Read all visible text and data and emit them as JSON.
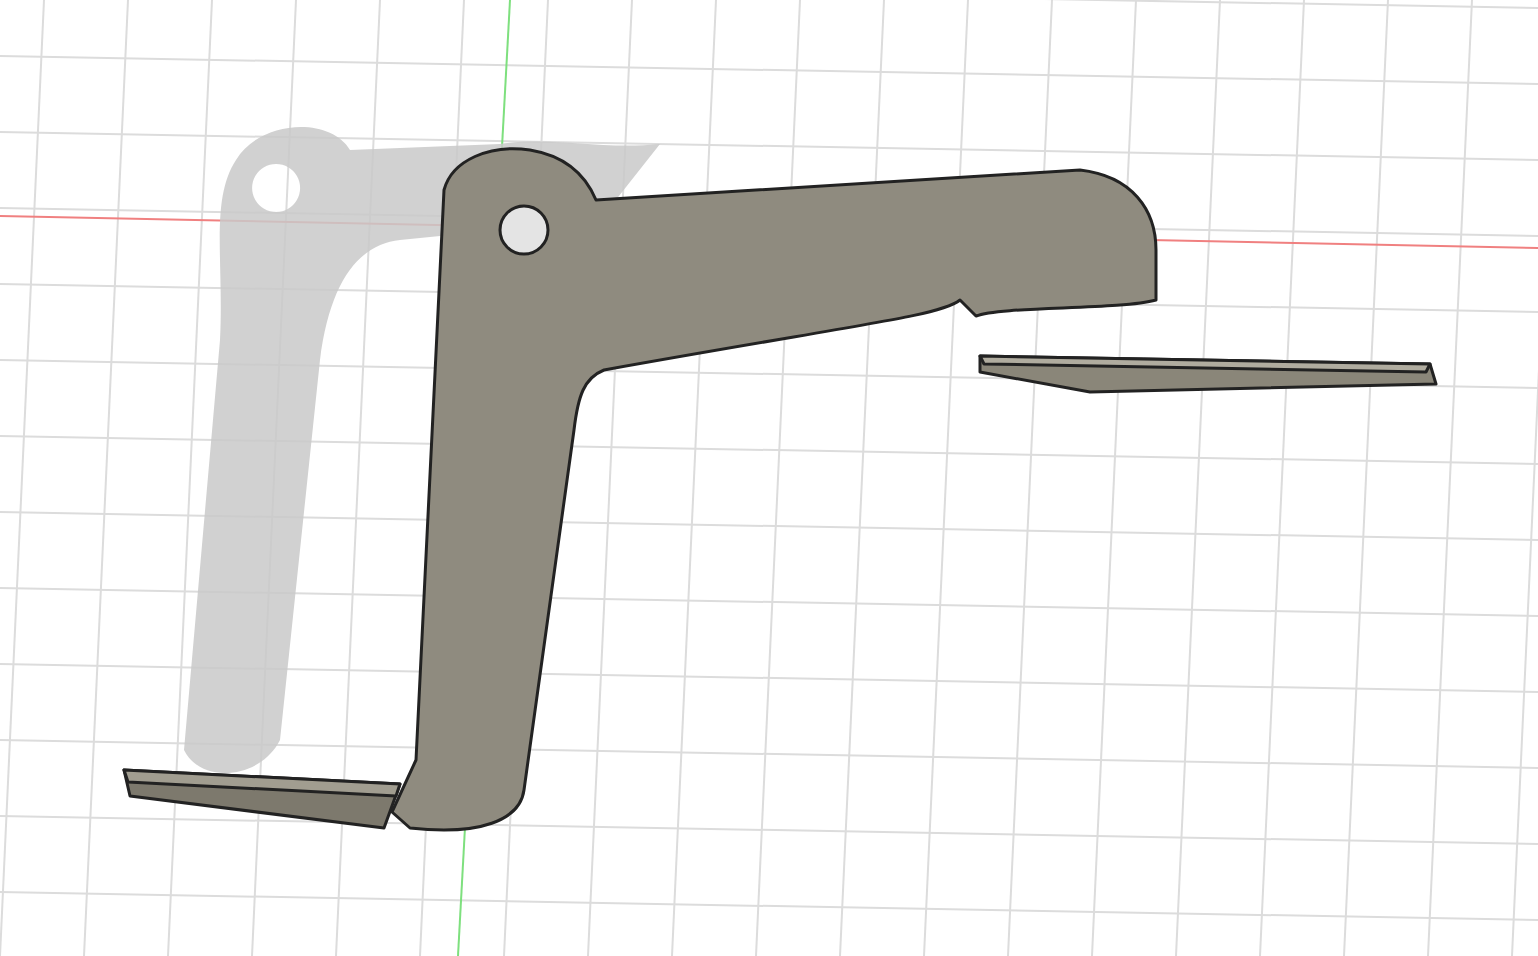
{
  "viewport": {
    "show_grid": true,
    "show_axes": true,
    "show_shadow": true
  }
}
